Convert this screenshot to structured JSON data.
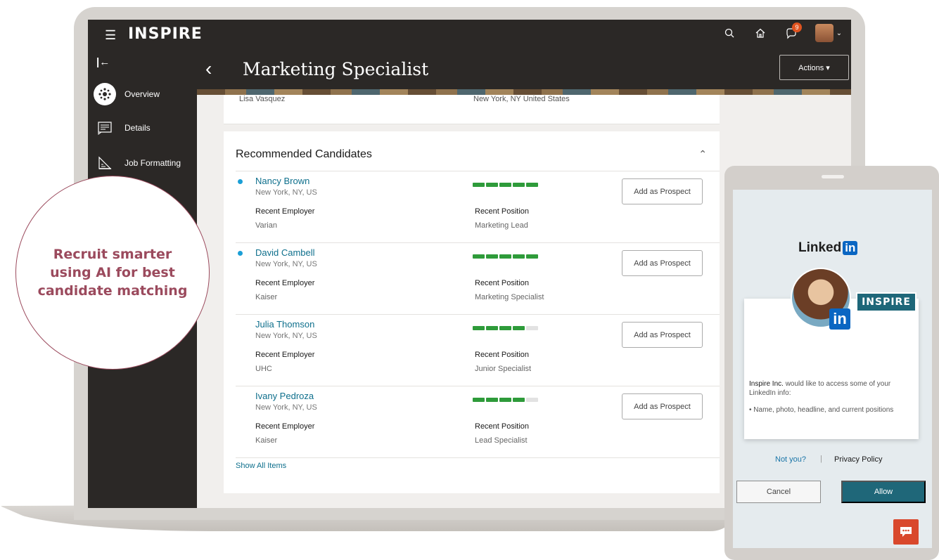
{
  "app": {
    "brand": "INSPIRE",
    "notification_count": "9"
  },
  "sidebar": {
    "items": [
      {
        "label": "Overview",
        "icon": "overview-icon",
        "active": true
      },
      {
        "label": "Details",
        "icon": "details-icon",
        "active": false
      },
      {
        "label": "Job Formatting",
        "icon": "job-formatting-icon",
        "active": false
      }
    ]
  },
  "page": {
    "title": "Marketing Specialist",
    "actions_label": "Actions ▾"
  },
  "top_card": {
    "name": "Lisa Vasquez",
    "location": "New York, NY United States"
  },
  "recommended": {
    "title": "Recommended Candidates",
    "show_all": "Show All Items",
    "employer_label": "Recent Employer",
    "position_label": "Recent Position",
    "prospect_label": "Add as Prospect",
    "candidates": [
      {
        "name": "Nancy Brown",
        "location": "New York, NY, US",
        "employer": "Varian",
        "position": "Marketing Lead",
        "match": 5,
        "new": true
      },
      {
        "name": "David Cambell",
        "location": "New York, NY, US",
        "employer": "Kaiser",
        "position": "Marketing Specialist",
        "match": 5,
        "new": true
      },
      {
        "name": "Julia Thomson",
        "location": "New York, NY, US",
        "employer": "UHC",
        "position": "Junior Specialist",
        "match": 4,
        "new": false
      },
      {
        "name": "Ivany Pedroza",
        "location": "New York, NY, US",
        "employer": "Kaiser",
        "position": "Lead Specialist",
        "match": 4,
        "new": false
      }
    ]
  },
  "callout": {
    "text": "Recruit smarter\nusing AI for best\ncandidate matching"
  },
  "linkedin": {
    "logo_text": "Linked",
    "logo_in": "in",
    "inspire_tag": "INSPIRE",
    "photo_in": "in",
    "company": "Inspire Inc.",
    "request": "would like to access some of your LinkedIn info:",
    "bullet": "•  Name, photo, headline, and current positions",
    "not_you": "Not you?",
    "separator": "|",
    "privacy": "Privacy Policy",
    "cancel": "Cancel",
    "allow": "Allow"
  },
  "colors": {
    "dark": "#2b2826",
    "link": "#0e6f8c",
    "match_bar": "#2e9b3a",
    "callout": "#9b4a5d",
    "allow": "#1f6779",
    "chat": "#d9482c"
  }
}
